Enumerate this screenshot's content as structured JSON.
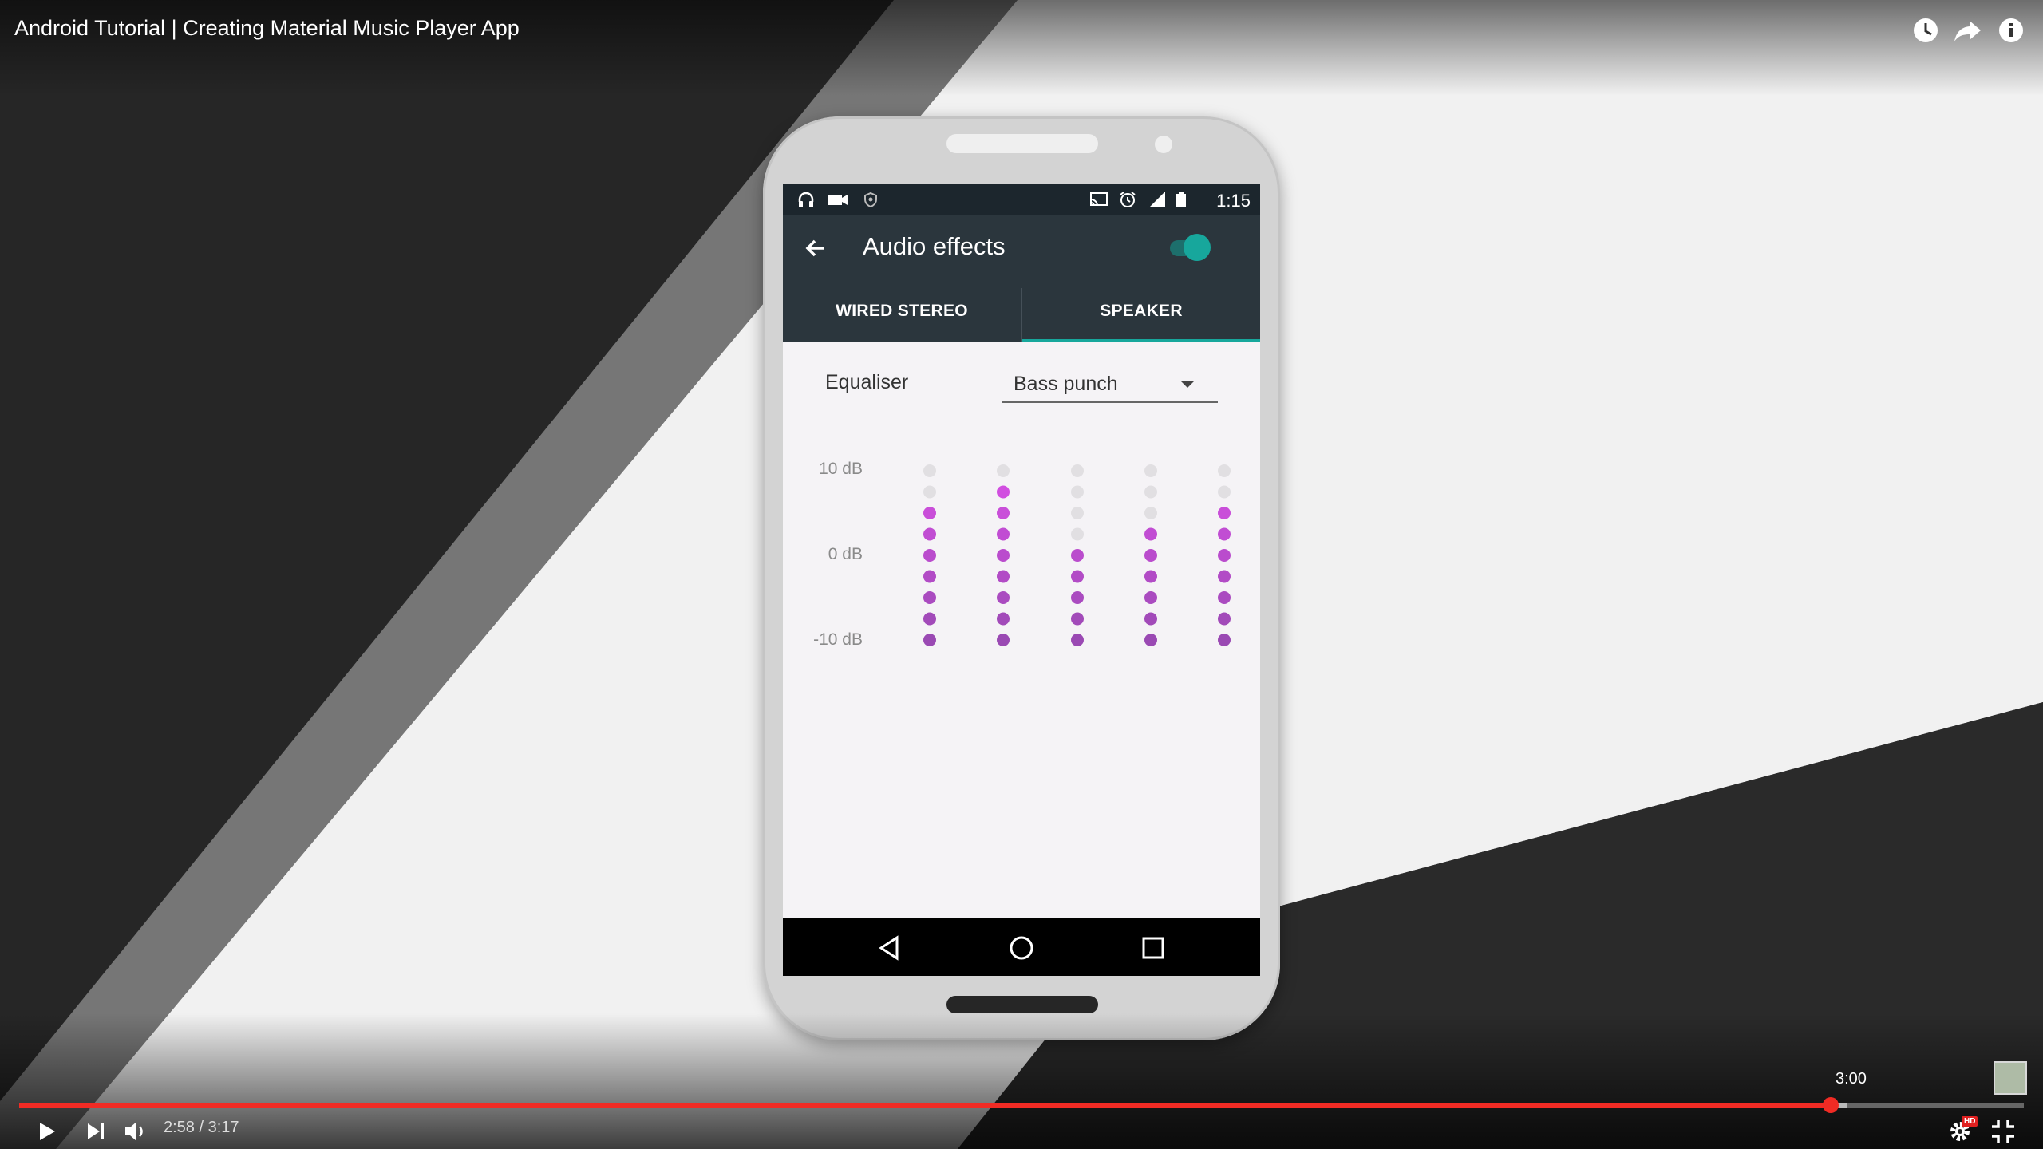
{
  "video": {
    "title": "Android Tutorial | Creating Material Music Player App"
  },
  "top_actions": [
    {
      "name": "watch-later-icon"
    },
    {
      "name": "share-icon"
    },
    {
      "name": "info-icon"
    }
  ],
  "phone": {
    "status_bar": {
      "left_icons": [
        "headphones-icon",
        "video-camera-icon",
        "vpn-shield-icon"
      ],
      "right_icons": [
        "cast-icon",
        "alarm-icon",
        "signal-icon",
        "battery-icon"
      ],
      "time": "1:15"
    },
    "app_bar": {
      "title": "Audio effects",
      "toggle_on": true
    },
    "tabs": [
      {
        "label": "WIRED STEREO",
        "selected": false
      },
      {
        "label": "SPEAKER",
        "selected": true
      }
    ],
    "equaliser": {
      "label": "Equaliser",
      "preset": "Bass punch",
      "db_labels": [
        "10 dB",
        "0 dB",
        "-10 dB"
      ],
      "steps_per_band": 9,
      "band_active_steps": [
        7,
        8,
        5,
        6,
        7
      ],
      "colors": {
        "active_top": "#d94fe6",
        "active_bottom": "#9a49b3",
        "inactive": "#e1dfe2"
      }
    },
    "nav_bar": [
      "back-triangle-icon",
      "home-circle-icon",
      "recents-square-icon"
    ]
  },
  "player": {
    "current_time": "2:58",
    "separator": " / ",
    "duration": "3:17",
    "hover_time": "3:00",
    "progress": 0.9035,
    "buffered": 0.912,
    "colors": {
      "progress": "#f12b24"
    },
    "controls": [
      "play-icon",
      "next-icon",
      "volume-icon",
      "settings-icon",
      "exit-fullscreen-icon"
    ],
    "hd_label": "HD"
  }
}
